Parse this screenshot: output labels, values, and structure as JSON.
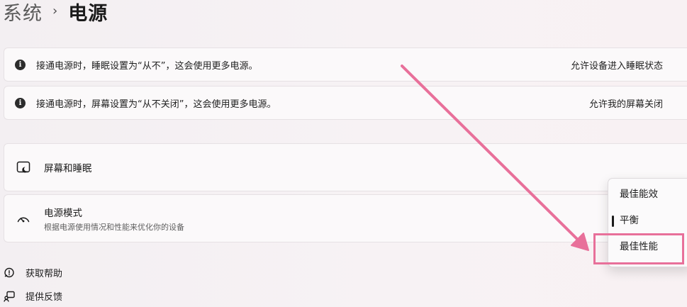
{
  "breadcrumb": {
    "parent": "系统",
    "separator": "›",
    "current": "电源"
  },
  "notices": [
    {
      "icon": "info-icon",
      "text": "接通电源时，睡眠设置为“从不”，这会使用更多电源。",
      "action": "允许设备进入睡眠状态"
    },
    {
      "icon": "info-icon",
      "text": "接通电源时，屏幕设置为“从不关闭”，这会使用更多电源。",
      "action": "允许我的屏幕关闭"
    }
  ],
  "settings": {
    "screen_sleep": {
      "icon": "screen-sleep-icon",
      "title": "屏幕和睡眠"
    },
    "power_mode": {
      "icon": "power-mode-gauge-icon",
      "title": "电源模式",
      "subtitle": "根据电源使用情况和性能来优化你的设备"
    }
  },
  "power_mode_dropdown": {
    "options": [
      "最佳能效",
      "平衡",
      "最佳性能"
    ],
    "selected": "平衡",
    "highlighted": "最佳性能"
  },
  "footer": {
    "help": {
      "icon": "get-help-icon",
      "label": "获取帮助"
    },
    "feedback": {
      "icon": "feedback-icon",
      "label": "提供反馈"
    }
  },
  "annotation": {
    "arrow_color": "#e8709a"
  }
}
